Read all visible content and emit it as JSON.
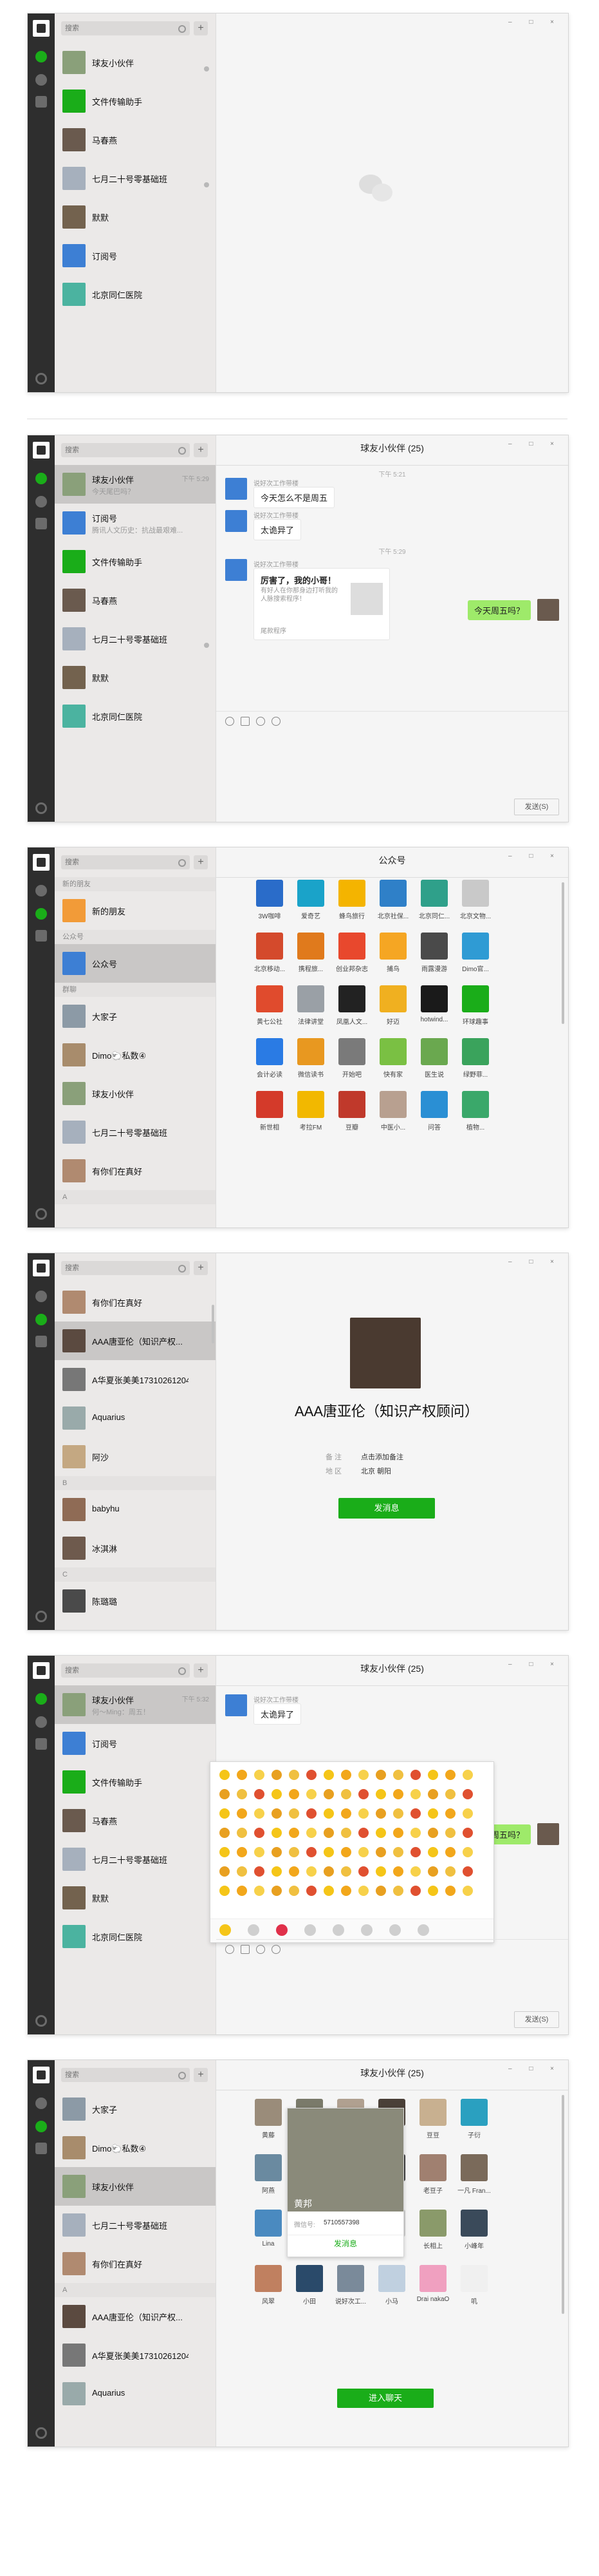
{
  "colors": {
    "brand_green": "#1aad19",
    "dark_rail": "#2e2e2e",
    "bubble_mine": "#9eea6a",
    "list_bg": "#ebe9e8",
    "selected_row": "#c9c7c6"
  },
  "window": {
    "controls": "– □ ×"
  },
  "search": {
    "placeholder": "搜索"
  },
  "add_icon": "+",
  "panel1": {
    "items": [
      {
        "name": "球友小伙伴"
      },
      {
        "name": "文件传输助手"
      },
      {
        "name": "马春燕"
      },
      {
        "name": "七月二十号零基础班"
      },
      {
        "name": "默默"
      },
      {
        "name": "订阅号"
      },
      {
        "name": "北京同仁医院"
      }
    ]
  },
  "panel2": {
    "items": [
      {
        "name": "球友小伙伴",
        "sub": "今天尾巴吗？",
        "time": "下午 5:29"
      },
      {
        "name": "订阅号",
        "sub": "腾讯人文历史：抗战最艰难..."
      },
      {
        "name": "文件传输助手"
      },
      {
        "name": "马春燕"
      },
      {
        "name": "七月二十号零基础班"
      },
      {
        "name": "默默"
      },
      {
        "name": "北京同仁医院"
      }
    ],
    "title": "球友小伙伴 (25)",
    "time1": "下午 5:21",
    "sender": "说好次工作带楼",
    "msg1": "今天怎么不是周五",
    "msg2": "太诡异了",
    "time2": "下午 5:29",
    "card_title": "厉害了，我的小哥！",
    "card_desc": "有好人在你那身边打听我的人脉搜索程序！",
    "card_source": "尾款程序",
    "my_msg": "今天周五吗？",
    "send": "发送(S)"
  },
  "panel3": {
    "headers": {
      "new": "新的朋友",
      "public": "公众号",
      "groups": "群聊",
      "a": "A"
    },
    "items": [
      {
        "name": "新的朋友"
      },
      {
        "name": "公众号"
      },
      {
        "name": "大家子"
      },
      {
        "name": "Dimo🐑私数④"
      },
      {
        "name": "球友小伙伴"
      },
      {
        "name": "七月二十号零基础班"
      },
      {
        "name": "有你们在真好"
      }
    ],
    "title": "公众号",
    "accounts": [
      "3W咖啡",
      "爱奇艺",
      "蜂鸟旅行",
      "北京社保...",
      "北京同仁...",
      "北京文物...",
      "北京移动...",
      "携程旅...",
      "创业邦杂志",
      "捕鸟",
      "雨露漫游",
      "Dimo官...",
      "黄七公社",
      "法律讲堂",
      "凤凰人文...",
      "好迈",
      "hotwind...",
      "环球趣事",
      "会计必读",
      "微信读书",
      "开始吧",
      "快有家",
      "医生说",
      "绿野菲...",
      "新世相",
      "考拉FM",
      "豆瓣",
      "中医小...",
      "问答",
      "植物..."
    ]
  },
  "panel4": {
    "items": [
      {
        "name": "有你们在真好"
      },
      {
        "name": "AAA唐亚伦（知识产权..."
      },
      {
        "name": "A华夏张美美17310261204"
      },
      {
        "name": "Aquarius"
      },
      {
        "name": "阿沙"
      },
      {
        "name": "babyhu"
      },
      {
        "name": "冰淇淋"
      },
      {
        "name": "陈璐璐"
      }
    ],
    "headers": {
      "b": "B",
      "c": "C"
    },
    "profile_name": "AAA唐亚伦（知识产权顾问）",
    "remark_label": "备 注",
    "remark_value": "点击添加备注",
    "region_label": "地 区",
    "region_value": "北京 朝阳",
    "send_btn": "发消息"
  },
  "panel5": {
    "items": [
      {
        "name": "球友小伙伴",
        "sub": "何～Ming：周五！",
        "time": "下午 5:32"
      },
      {
        "name": "订阅号"
      },
      {
        "name": "文件传输助手"
      },
      {
        "name": "马春燕"
      },
      {
        "name": "七月二十号零基础班"
      },
      {
        "name": "默默"
      },
      {
        "name": "北京同仁医院"
      }
    ],
    "title": "球友小伙伴 (25)",
    "sender": "说好次工作带楼",
    "msg": "太诡异了",
    "my_msg": "今天周五吗？",
    "send": "发送(S)"
  },
  "panel6": {
    "items": [
      {
        "name": "大家子"
      },
      {
        "name": "Dimo🐑私数④"
      },
      {
        "name": "球友小伙伴"
      },
      {
        "name": "七月二十号零基础班"
      },
      {
        "name": "有你们在真好"
      },
      {
        "name": "AAA唐亚伦（知识产权..."
      },
      {
        "name": "A华夏张美美17310261204"
      },
      {
        "name": "Aquarius"
      }
    ],
    "header_a": "A",
    "title": "球友小伙伴 (25)",
    "members": [
      "黄藤",
      "",
      "",
      "哦哦",
      "豆豆",
      "子衍",
      "阿燕",
      "",
      "",
      "尚方",
      "老豆子",
      "一凡 Fran...",
      "Lina",
      "babyhu",
      "奶饮",
      "",
      "长相上",
      "小峰年",
      "风翠",
      "小田",
      "说好次工...",
      "小马",
      "Drai nakaO",
      "叽"
    ],
    "popup_name": "黄邦",
    "popup_id_label": "微信号:",
    "popup_id": "5710557398",
    "popup_btn": "发消息",
    "join_btn": "进入聊天"
  }
}
